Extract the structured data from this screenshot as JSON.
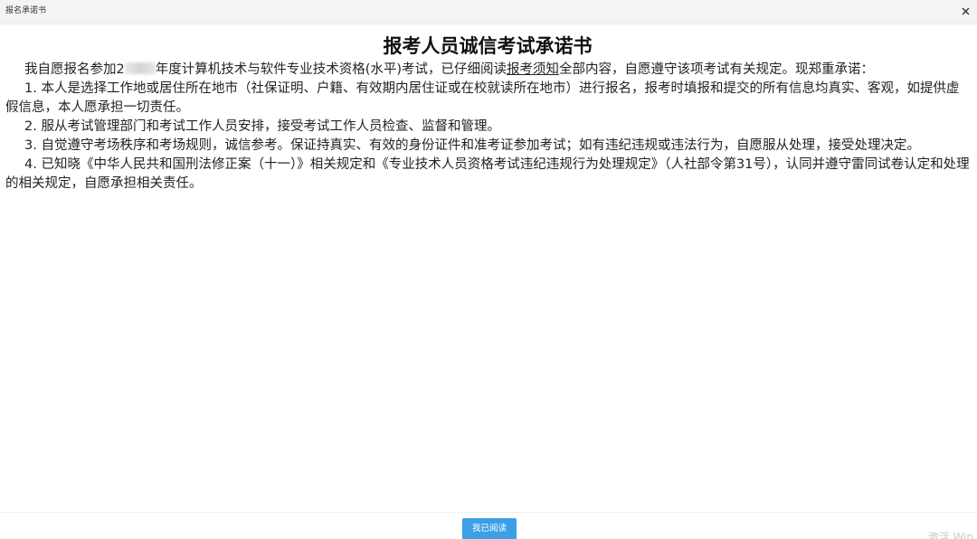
{
  "window": {
    "title": "报名承诺书",
    "close_icon": "close-icon"
  },
  "document": {
    "title": "报考人员诚信考试承诺书",
    "intro_before": "我自愿报名参加2",
    "intro_after_blur": "年度计算机技术与软件专业技术资格(水平)考试，已仔细阅读",
    "intro_link": "报考须知",
    "intro_end": "全部内容，自愿遵守该项考试有关规定。现郑重承诺：",
    "items": [
      "1. 本人是选择工作地或居住所在地市（社保证明、户籍、有效期内居住证或在校就读所在地市）进行报名，报考时填报和提交的所有信息均真实、客观，如提供虚假信息，本人愿承担一切责任。",
      "2. 服从考试管理部门和考试工作人员安排，接受考试工作人员检查、监督和管理。",
      "3. 自觉遵守考场秩序和考场规则，诚信参考。保证持真实、有效的身份证件和准考证参加考试；如有违纪违规或违法行为，自愿服从处理，接受处理决定。",
      "4. 已知晓《中华人民共和国刑法修正案（十一）》相关规定和《专业技术人员资格考试违纪违规行为处理规定》（人社部令第31号），认同并遵守雷同试卷认定和处理的相关规定，自愿承担相关责任。"
    ]
  },
  "footer": {
    "read_button": "我已阅读",
    "watermark": "激活 Win"
  },
  "colors": {
    "button_bg": "#3ba0e6",
    "titlebar_bg": "#f4f4f4"
  }
}
